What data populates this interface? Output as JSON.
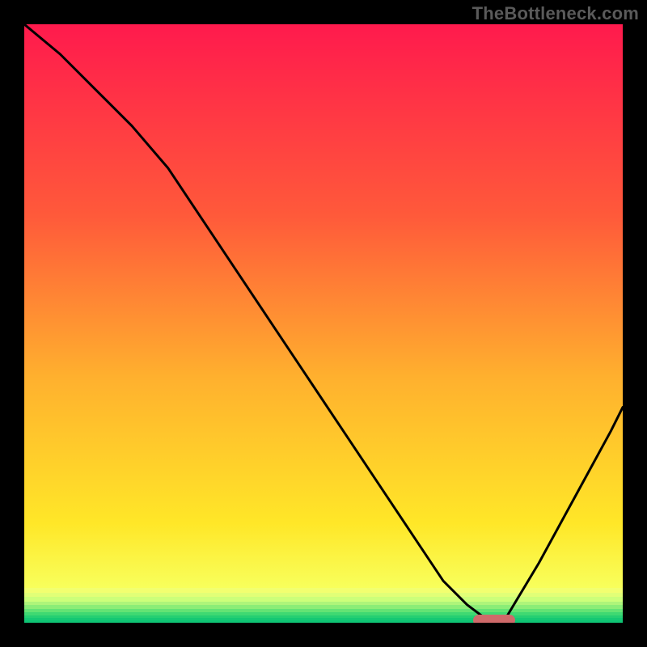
{
  "watermark": "TheBottleneck.com",
  "chart_data": {
    "type": "line",
    "title": "",
    "xlabel": "",
    "ylabel": "",
    "x": [
      0.0,
      0.06,
      0.12,
      0.18,
      0.24,
      0.3,
      0.36,
      0.42,
      0.48,
      0.54,
      0.6,
      0.66,
      0.7,
      0.74,
      0.78,
      0.8,
      0.86,
      0.92,
      0.98,
      1.0
    ],
    "values": [
      1.0,
      0.95,
      0.89,
      0.83,
      0.76,
      0.67,
      0.58,
      0.49,
      0.4,
      0.31,
      0.22,
      0.13,
      0.07,
      0.03,
      0.0,
      0.0,
      0.1,
      0.21,
      0.32,
      0.36
    ],
    "xlim": [
      0,
      1
    ],
    "ylim": [
      0,
      1
    ],
    "optimal_range": {
      "x_start": 0.75,
      "x_end": 0.82,
      "y": 0.0
    },
    "background_gradient": {
      "soft_stops": [
        {
          "position": 0.0,
          "color": "#ff1a4d"
        },
        {
          "position": 0.3,
          "color": "#ff5a3a"
        },
        {
          "position": 0.55,
          "color": "#ffb02e"
        },
        {
          "position": 0.78,
          "color": "#ffe728"
        },
        {
          "position": 0.88,
          "color": "#f8ff5c"
        }
      ],
      "hard_bands": [
        {
          "height_fraction": 0.008,
          "color": "#f2ff70"
        },
        {
          "height_fraction": 0.0075,
          "color": "#e1ff77"
        },
        {
          "height_fraction": 0.007,
          "color": "#ccff7a"
        },
        {
          "height_fraction": 0.0065,
          "color": "#aef57a"
        },
        {
          "height_fraction": 0.006,
          "color": "#8bed77"
        },
        {
          "height_fraction": 0.0055,
          "color": "#63e374"
        },
        {
          "height_fraction": 0.005,
          "color": "#3fd972"
        },
        {
          "height_fraction": 0.0045,
          "color": "#25cf72"
        },
        {
          "height_fraction": 0.0042,
          "color": "#15c873"
        },
        {
          "height_fraction": 0.004,
          "color": "#0fc474"
        }
      ]
    }
  }
}
